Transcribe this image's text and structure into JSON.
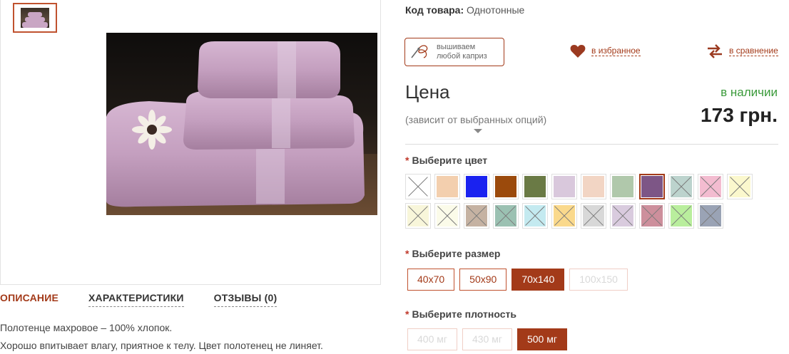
{
  "gallery": {
    "thumbnails": [
      {
        "name": "towel-set-thumb",
        "selected": true
      }
    ],
    "main_image": {
      "name": "pink-towel-stack-photo"
    }
  },
  "tabs": [
    {
      "label": "ОПИСАНИЕ",
      "active": true
    },
    {
      "label": "ХАРАКТЕРИСТИКИ",
      "active": false
    },
    {
      "label": "ОТЗЫВЫ (0)",
      "active": false
    }
  ],
  "description": [
    "Полотенце махровое – 100% хлопок.",
    "Хорошо впитывает влагу, приятное к телу. Цвет полотенец не линяет."
  ],
  "product": {
    "sku_label": "Код товара:",
    "sku_value": "Однотонные",
    "embroidery_label": "вышиваем любой каприз",
    "favorite_label": "в избранное",
    "compare_label": "в сравнение",
    "price_title": "Цена",
    "price_note": "(зависит от выбранных опций)",
    "stock": "в наличии",
    "price": "173 грн."
  },
  "options": {
    "color_title": "Выберите цвет",
    "size_title": "Выберите размер",
    "density_title": "Выберите плотность",
    "colors": [
      {
        "hex": "#ffffff",
        "available": false,
        "selected": false
      },
      {
        "hex": "#f3cfae",
        "available": true,
        "selected": false
      },
      {
        "hex": "#1a22f0",
        "available": true,
        "selected": false
      },
      {
        "hex": "#9b4a0c",
        "available": true,
        "selected": false
      },
      {
        "hex": "#6a7a45",
        "available": true,
        "selected": false
      },
      {
        "hex": "#d9c8dc",
        "available": true,
        "selected": false
      },
      {
        "hex": "#f2d5c4",
        "available": true,
        "selected": false
      },
      {
        "hex": "#b0c8ab",
        "available": true,
        "selected": false
      },
      {
        "hex": "#7d5686",
        "available": true,
        "selected": true
      },
      {
        "hex": "#bcd3cd",
        "available": false,
        "selected": false
      },
      {
        "hex": "#f3bcd0",
        "available": false,
        "selected": false
      },
      {
        "hex": "#fbf8cd",
        "available": false,
        "selected": false
      },
      {
        "hex": "#f8f6da",
        "available": false,
        "selected": false
      },
      {
        "hex": "#fbfbe9",
        "available": false,
        "selected": false
      },
      {
        "hex": "#c5b2a2",
        "available": false,
        "selected": false
      },
      {
        "hex": "#9bc1b2",
        "available": false,
        "selected": false
      },
      {
        "hex": "#c4eaf0",
        "available": false,
        "selected": false
      },
      {
        "hex": "#fad98c",
        "available": false,
        "selected": false
      },
      {
        "hex": "#d8d8d8",
        "available": false,
        "selected": false
      },
      {
        "hex": "#d9cbde",
        "available": false,
        "selected": false
      },
      {
        "hex": "#cd8f9c",
        "available": false,
        "selected": false
      },
      {
        "hex": "#b9ee9d",
        "available": false,
        "selected": false
      },
      {
        "hex": "#9aa3b5",
        "available": false,
        "selected": false
      }
    ],
    "sizes": [
      {
        "label": "40x70",
        "state": "available"
      },
      {
        "label": "50x90",
        "state": "available"
      },
      {
        "label": "70x140",
        "state": "selected"
      },
      {
        "label": "100x150",
        "state": "disabled"
      }
    ],
    "densities": [
      {
        "label": "400 мг",
        "state": "disabled"
      },
      {
        "label": "430 мг",
        "state": "disabled"
      },
      {
        "label": "500 мг",
        "state": "selected"
      }
    ]
  },
  "colors": {
    "accent": "#a33a19",
    "stock": "#3a9a3a"
  }
}
